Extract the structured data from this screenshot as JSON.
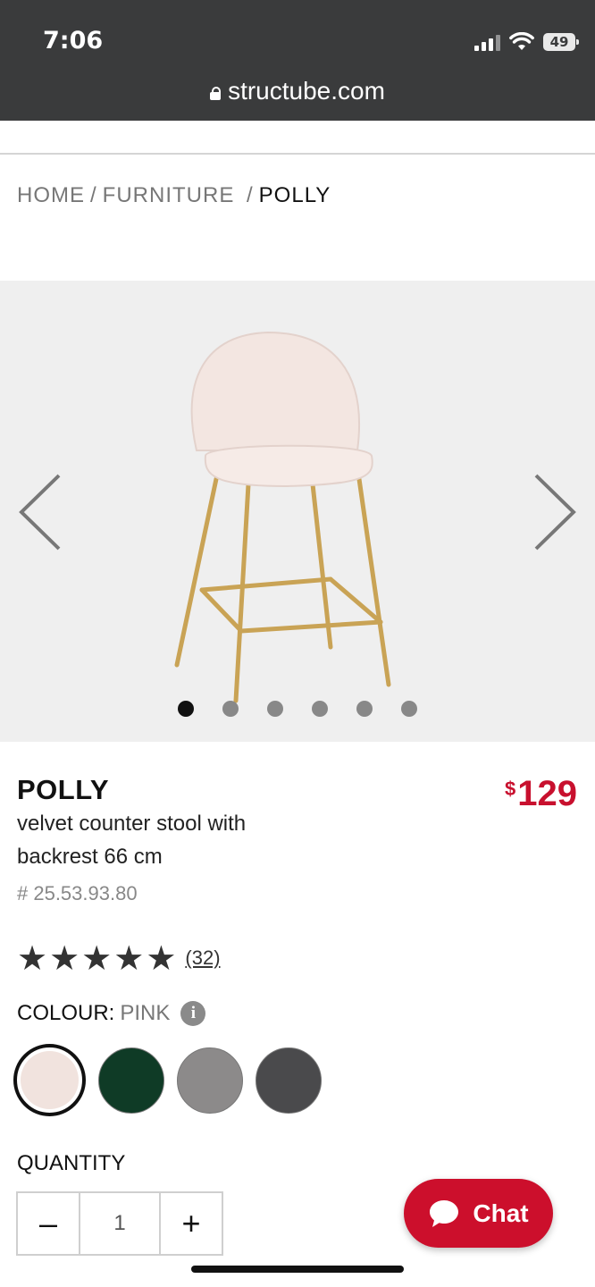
{
  "status_bar": {
    "time": "7:06",
    "battery": "49"
  },
  "browser": {
    "url": "structube.com"
  },
  "breadcrumb": {
    "home": "HOME",
    "category": "FURNITURE",
    "current": "POLLY",
    "separator": "/"
  },
  "gallery": {
    "image_count": 6,
    "active_index": 0
  },
  "product": {
    "name": "POLLY",
    "description": "velvet counter stool with backrest 66 cm",
    "sku": "# 25.53.93.80",
    "price_currency": "$",
    "price": "129",
    "rating": 5,
    "reviews": "(32)"
  },
  "colour": {
    "label": "COLOUR:",
    "selected": "PINK",
    "info_icon": "i",
    "swatches": [
      {
        "name": "pink",
        "color": "#f1e3de"
      },
      {
        "name": "green",
        "color": "#0f3b26"
      },
      {
        "name": "grey",
        "color": "#8c8a8a"
      },
      {
        "name": "charcoal",
        "color": "#4a4a4c"
      }
    ]
  },
  "quantity": {
    "label": "QUANTITY",
    "value": "1",
    "minus": "–",
    "plus": "+"
  },
  "chat": {
    "label": "Chat"
  },
  "colors": {
    "accent": "#cc0f2c",
    "topbar": "#3a3b3c"
  }
}
